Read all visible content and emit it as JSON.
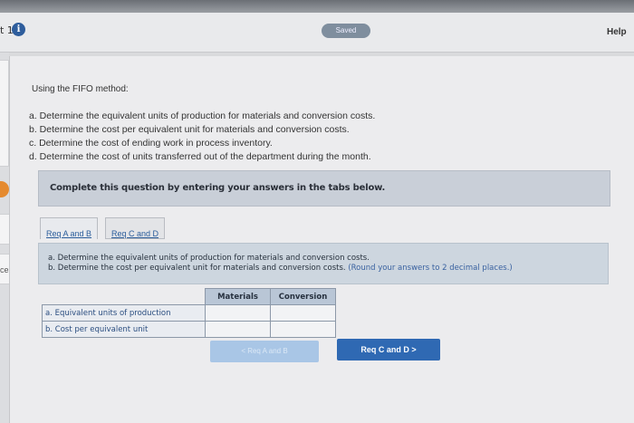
{
  "header": {
    "question_fragment": "t 1",
    "info_icon_glyph": "i",
    "saved_label": "Saved",
    "help_label": "Help"
  },
  "side": {
    "fragment": "ces"
  },
  "question": {
    "intro": "Using the FIFO method:",
    "requirements": [
      "a. Determine the equivalent units of production for materials and conversion costs.",
      "b. Determine the cost per equivalent unit for materials and conversion costs.",
      "c. Determine the cost of ending work in process inventory.",
      "d. Determine the cost of units transferred out of the department during the month."
    ]
  },
  "banner": {
    "text": "Complete this question by entering your answers in the tabs below."
  },
  "tabs": [
    {
      "label": "Req A and B",
      "active": true
    },
    {
      "label": "Req C and D",
      "active": false
    }
  ],
  "instructions": {
    "line1": "a. Determine the equivalent units of production for materials and conversion costs.",
    "line2_main": "b. Determine the cost per equivalent unit for materials and conversion costs.",
    "line2_note": "(Round your answers to 2 decimal places.)"
  },
  "table": {
    "columns": [
      "Materials",
      "Conversion"
    ],
    "rows": [
      {
        "label": "a. Equivalent units of production",
        "materials": "",
        "conversion": ""
      },
      {
        "label": "b. Cost per equivalent unit",
        "materials": "",
        "conversion": ""
      }
    ]
  },
  "nav": {
    "prev_label": "< Req A and B",
    "next_label": "Req C and D  >"
  },
  "colors": {
    "accent": "#2f69b3",
    "banner": "#c9cfd8",
    "saved_pill": "#7f8e9e"
  }
}
